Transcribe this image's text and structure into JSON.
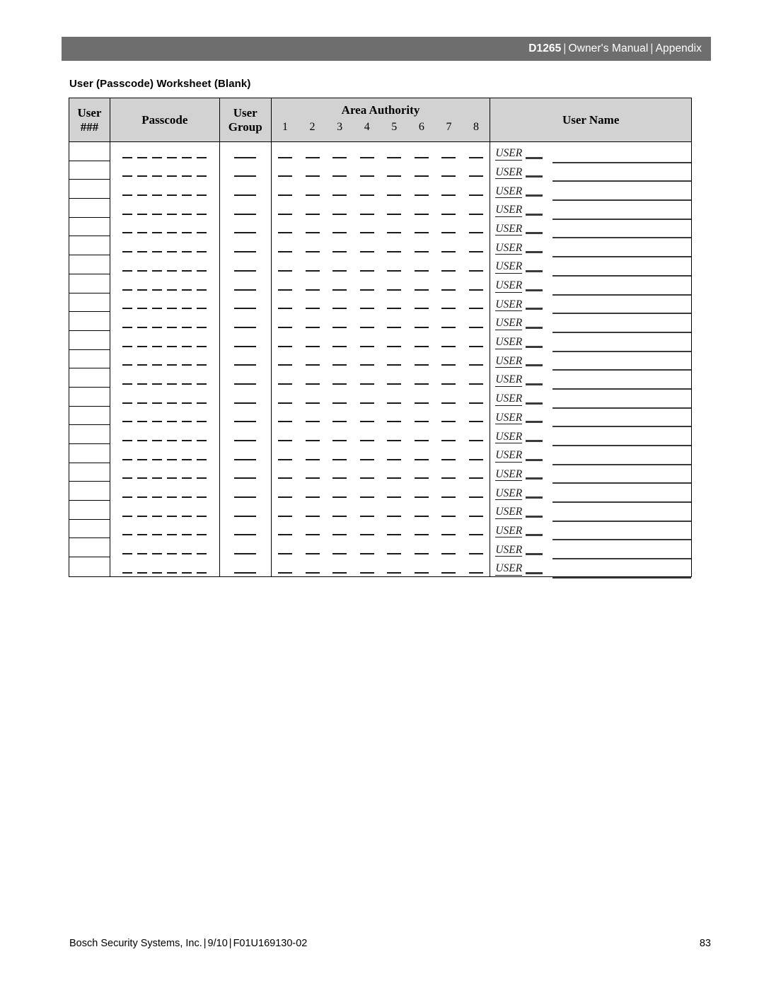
{
  "header": {
    "model": "D1265",
    "separator": "|",
    "manual": "Owner's Manual",
    "section": "Appendix",
    "bar_color": "#6e6e6e",
    "text_color": "#ffffff"
  },
  "worksheet": {
    "title": "User (Passcode) Worksheet (Blank)",
    "header_bg": "#d2d2d2",
    "columns": {
      "user_number_line1": "User",
      "user_number_line2": "###",
      "passcode": "Passcode",
      "user_group_line1": "User",
      "user_group_line2": "Group",
      "area_authority": "Area Authority",
      "user_name": "User Name"
    },
    "area_numbers": [
      "1",
      "2",
      "3",
      "4",
      "5",
      "6",
      "7",
      "8"
    ],
    "row_label": "USER",
    "row_count": 23,
    "passcode_dashes": 6,
    "group_dashes": 1,
    "area_dashes": 8
  },
  "footer": {
    "company": "Bosch Security Systems, Inc.",
    "separator": "|",
    "date": "9/10",
    "document_id": "F01U169130-02",
    "page_number": "83"
  }
}
